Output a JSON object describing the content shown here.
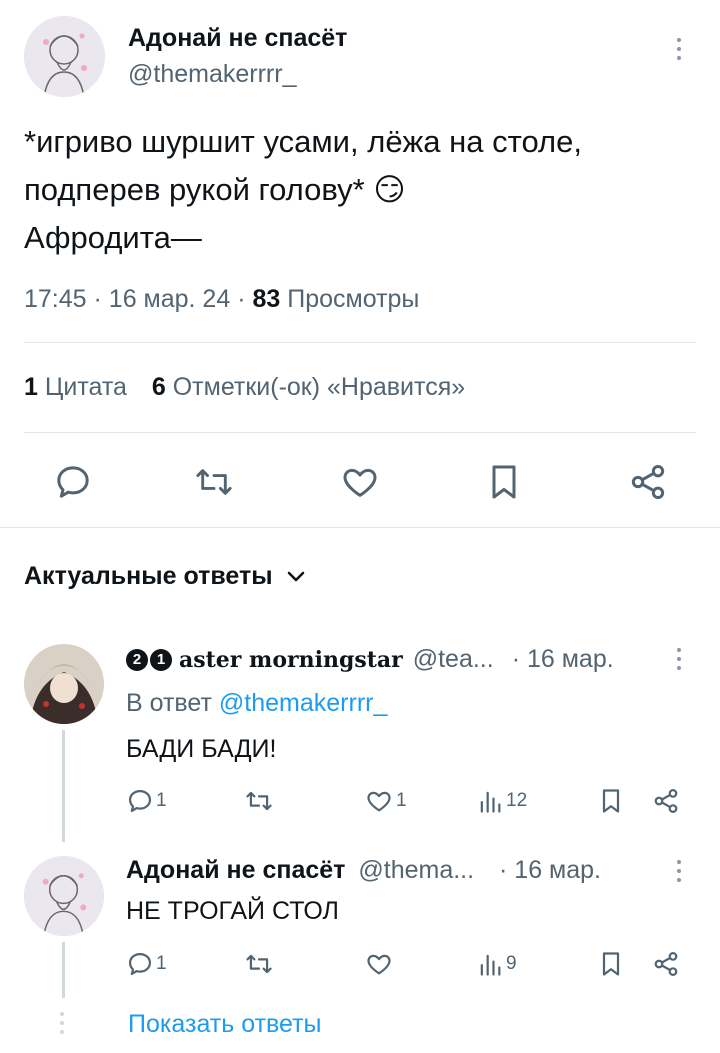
{
  "tweet": {
    "author_name": "Адонай не спасёт",
    "author_handle": "@themakerrrr_",
    "text_line1": "*игриво шуршит усами, лёжа на столе,",
    "text_line2": "подперев рукой голову* 😏",
    "text_line3": "Афродита—",
    "time": "17:45",
    "date": "16 мар. 24",
    "views_count": "83",
    "views_label": "Просмотры",
    "sep": "·"
  },
  "stats": {
    "quotes_count": "1",
    "quotes_label": "Цитата",
    "likes_count": "6",
    "likes_label": "Отметки(-ок) «Нравится»"
  },
  "actions": [
    "reply-icon",
    "retweet-icon",
    "like-icon",
    "bookmark-icon",
    "share-icon"
  ],
  "replies_sort": {
    "label": "Актуальные ответы"
  },
  "replies": [
    {
      "badge1": "2",
      "badge2": "1",
      "name": "aster morningstar",
      "handle": "@tea...",
      "date": "· 16 мар.",
      "reply_to_prefix": "В ответ",
      "reply_to_handle": "@themakerrrr_",
      "text": "БАДИ БАДИ!",
      "reply_count": "1",
      "retweet_count": "",
      "like_count": "1",
      "view_count": "12"
    },
    {
      "name": "Адонай не спасёт",
      "handle": "@thema...",
      "date": "· 16 мар.",
      "text": "НЕ ТРОГАЙ СТОЛ",
      "reply_count": "1",
      "retweet_count": "",
      "like_count": "",
      "view_count": "9"
    }
  ],
  "show_replies": "Показать ответы",
  "colors": {
    "accent": "#1d9bf0",
    "text": "#0f1419",
    "secondary": "#536471",
    "divider": "#e1e6ea"
  }
}
